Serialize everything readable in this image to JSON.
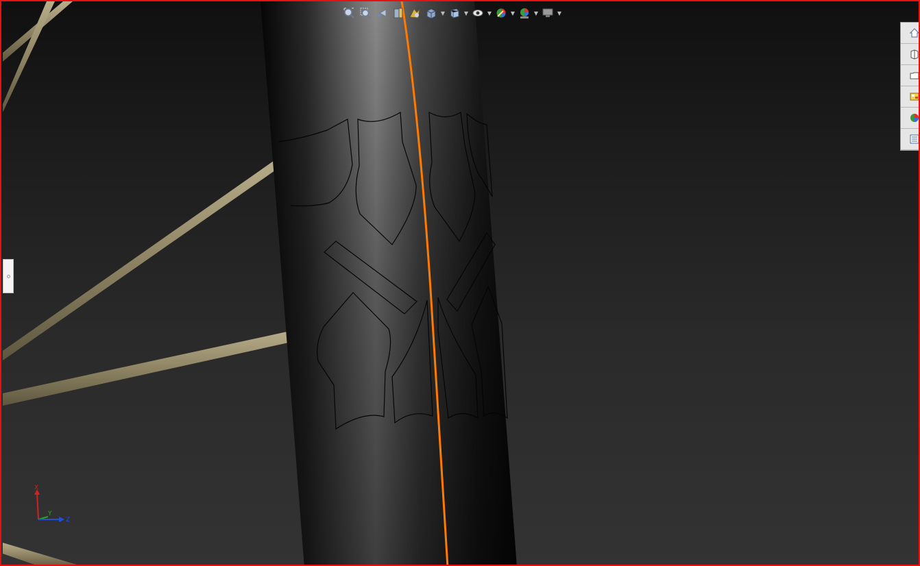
{
  "app": "3D CAD modeling viewport",
  "colors": {
    "viewport_border": "#e81010",
    "background_top": "#101010",
    "background_bottom": "#333333",
    "rod_color": "#8f8565",
    "split_line": "#ff7a00",
    "sketch_outline": "#050505"
  },
  "heads_up_toolbar": {
    "buttons": [
      {
        "icon": "zoom-to-fit-icon",
        "has_dropdown": false
      },
      {
        "icon": "zoom-to-area-icon",
        "has_dropdown": false
      },
      {
        "icon": "previous-view-icon",
        "has_dropdown": false
      },
      {
        "icon": "section-view-icon",
        "has_dropdown": false
      },
      {
        "icon": "dynamic-annotation-views-icon",
        "has_dropdown": false
      },
      {
        "icon": "view-orientation-icon",
        "has_dropdown": true
      },
      {
        "icon": "display-style-icon",
        "has_dropdown": true
      },
      {
        "icon": "hide-show-items-icon",
        "has_dropdown": true
      },
      {
        "icon": "edit-appearance-icon",
        "has_dropdown": true
      },
      {
        "icon": "apply-scene-icon",
        "has_dropdown": true
      },
      {
        "icon": "view-settings-icon",
        "has_dropdown": true
      }
    ]
  },
  "task_pane": {
    "tabs": [
      {
        "icon": "home-resources-icon"
      },
      {
        "icon": "design-library-icon"
      },
      {
        "icon": "file-explorer-icon"
      },
      {
        "icon": "view-palette-icon"
      },
      {
        "icon": "appearances-scenes-icon"
      },
      {
        "icon": "custom-properties-icon"
      }
    ]
  },
  "triad": {
    "x_label": "X",
    "y_label": "Y",
    "z_label": "Z"
  }
}
